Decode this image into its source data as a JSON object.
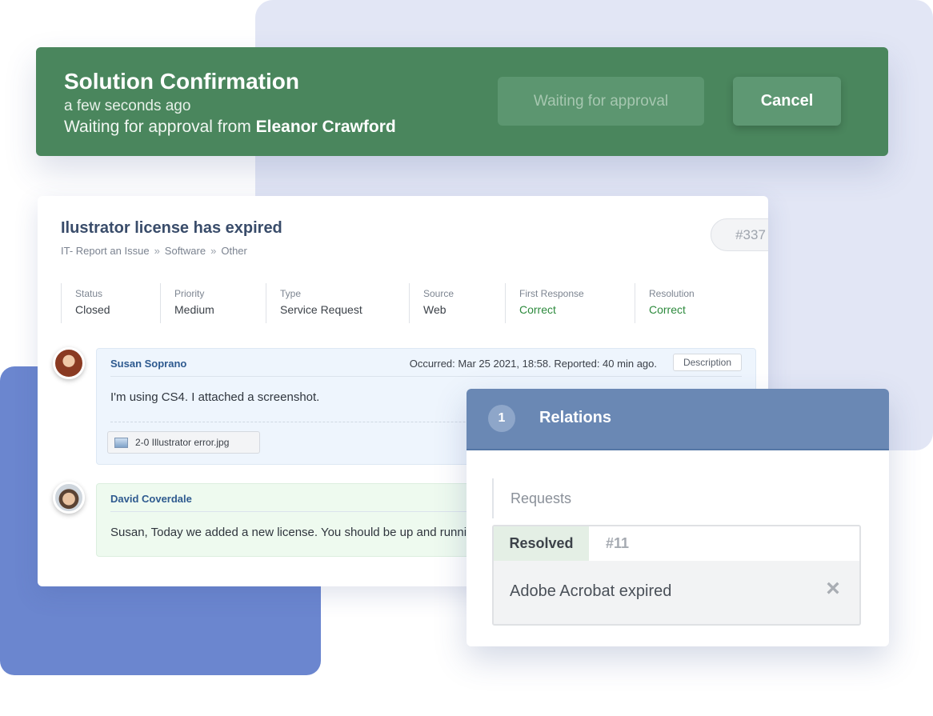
{
  "banner": {
    "title": "Solution Confirmation",
    "time": "a few seconds ago",
    "waiting_prefix": "Waiting for approval from",
    "approver": "Eleanor Crawford",
    "status_button": "Waiting for approval",
    "cancel_button": "Cancel"
  },
  "ticket": {
    "title": "Ilustrator license has expired",
    "breadcrumb": [
      "IT- Report an Issue",
      "Software",
      "Other"
    ],
    "breadcrumb_separator": "»",
    "number": "#337",
    "fields": [
      {
        "label": "Status",
        "value": "Closed"
      },
      {
        "label": "Priority",
        "value": "Medium"
      },
      {
        "label": "Type",
        "value": "Service Request"
      },
      {
        "label": "Source",
        "value": "Web"
      },
      {
        "label": "First Response",
        "value": "Correct"
      },
      {
        "label": "Resolution",
        "value": "Correct"
      }
    ],
    "comments": [
      {
        "author": "Susan Soprano",
        "meta": "Occurred: Mar 25 2021, 18:58. Reported: 40 min ago.",
        "tag": "Description",
        "text": "I'm using CS4. I attached a screenshot.",
        "attachment": "2-0 Illustrator error.jpg"
      },
      {
        "author": "David Coverdale",
        "text": "Susan, Today we added a new license. You should be up and running ag"
      }
    ]
  },
  "relations": {
    "count": "1",
    "title": "Relations",
    "section_label": "Requests",
    "items": [
      {
        "status": "Resolved",
        "id": "#11",
        "name": "Adobe Acrobat expired",
        "remove_icon": "close-icon"
      }
    ]
  },
  "colors": {
    "banner_green": "#4a865d",
    "relations_header": "#6a88b4",
    "correct_green": "#2d8a3d",
    "author_blue": "#2e5a8f"
  }
}
